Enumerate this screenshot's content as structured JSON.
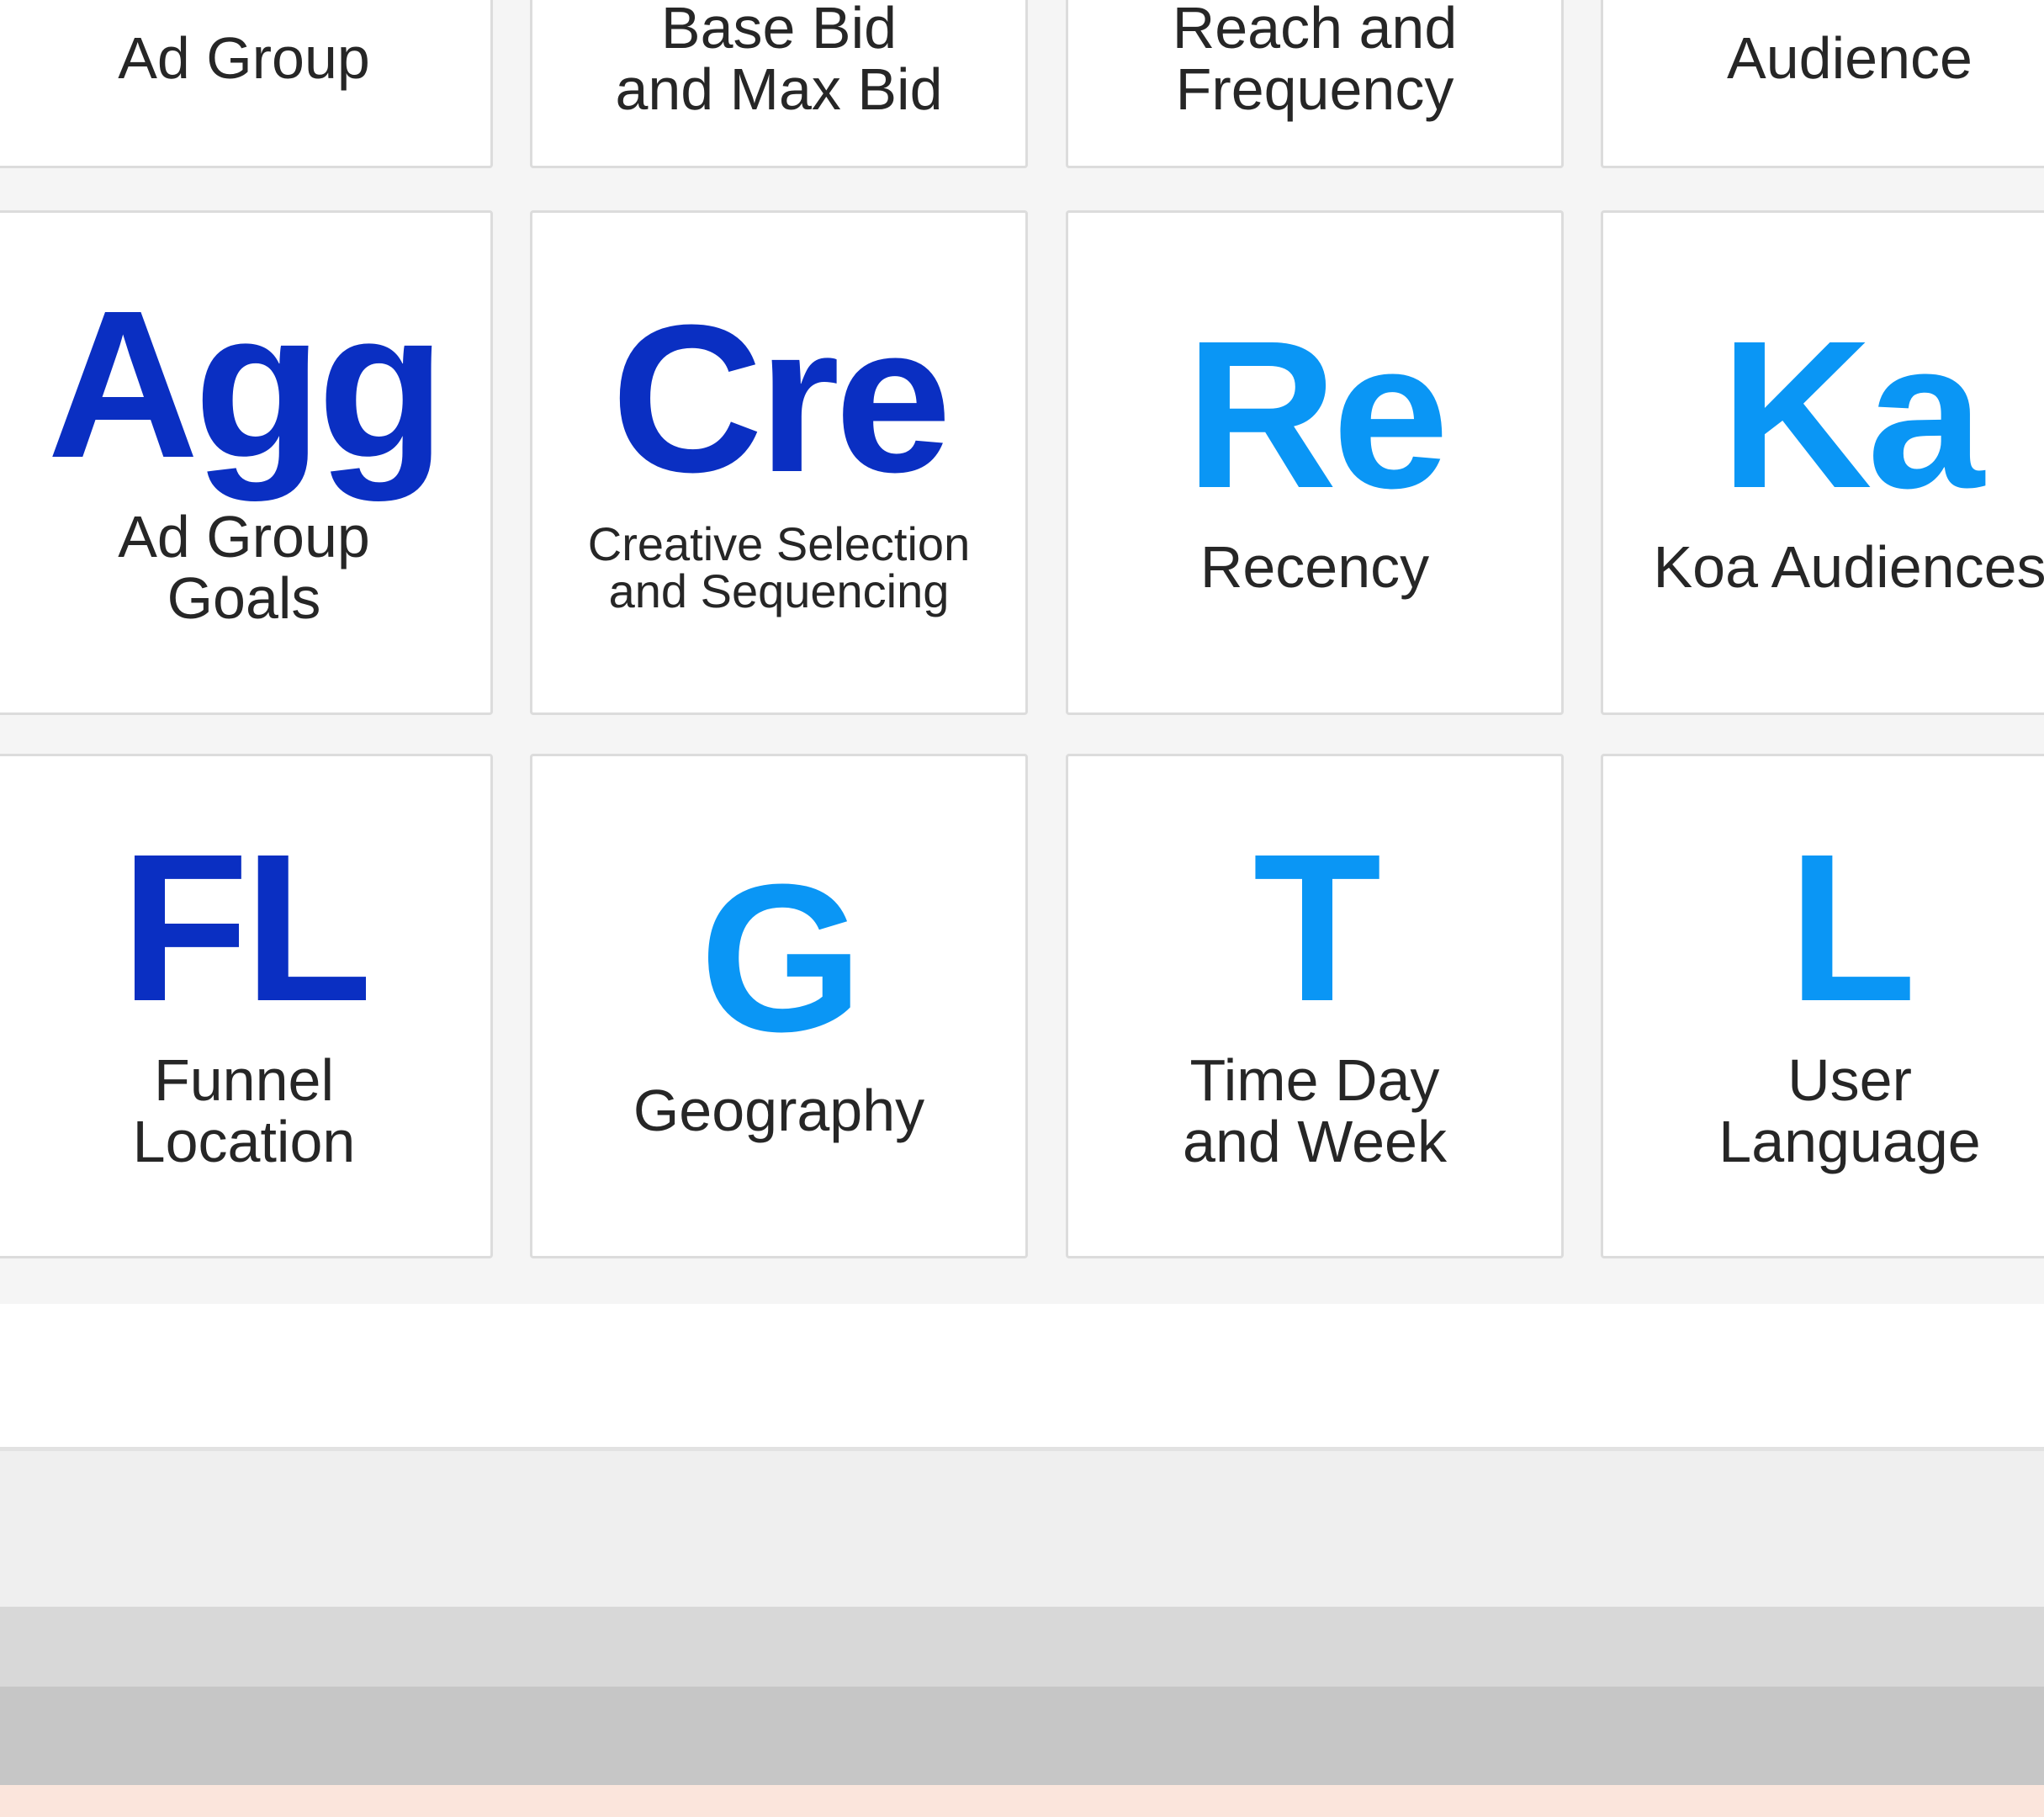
{
  "colors": {
    "dark_blue": "#0a2fc2",
    "light_blue": "#0a96f5"
  },
  "tiles": [
    {
      "symbol": "",
      "name": "Ad Group",
      "color": ""
    },
    {
      "symbol": "",
      "name": "Base Bid\nand Max Bid",
      "color": ""
    },
    {
      "symbol": "",
      "name": "Reach and\nFrequency",
      "color": ""
    },
    {
      "symbol": "",
      "name": "Audience",
      "color": ""
    },
    {
      "symbol": "Agg",
      "name": "Ad Group\nGoals",
      "color": "dark_blue"
    },
    {
      "symbol": "Cre",
      "name": "Creative Selection\nand Sequencing",
      "color": "dark_blue"
    },
    {
      "symbol": "Re",
      "name": "Recency",
      "color": "light_blue"
    },
    {
      "symbol": "Ka",
      "name": "Koa Audiences",
      "color": "light_blue"
    },
    {
      "symbol": "FL",
      "name": "Funnel\nLocation",
      "color": "dark_blue"
    },
    {
      "symbol": "G",
      "name": "Geography",
      "color": "light_blue"
    },
    {
      "symbol": "T",
      "name": "Time Day\nand Week",
      "color": "light_blue"
    },
    {
      "symbol": "L",
      "name": "User\nLanguage",
      "color": "light_blue"
    }
  ]
}
